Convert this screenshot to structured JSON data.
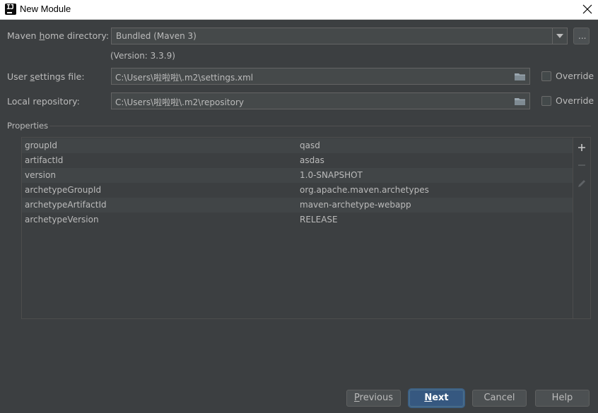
{
  "window": {
    "title": "New Module",
    "icon": "intellij-idea-icon",
    "close_icon": "close-icon"
  },
  "form": {
    "maven_home": {
      "label_pre": "Maven ",
      "label_mnemonic": "h",
      "label_post": "ome directory:",
      "value": "Bundled (Maven 3)",
      "browse_label": "...",
      "version": "(Version: 3.3.9)"
    },
    "user_settings": {
      "label_pre": "User ",
      "label_mnemonic": "s",
      "label_post": "ettings file:",
      "value": "C:\\Users\\啦啦啦\\.m2\\settings.xml",
      "override_label": "Override",
      "override_checked": false
    },
    "local_repo": {
      "label": "Local repository:",
      "value": "C:\\Users\\啦啦啦\\.m2\\repository",
      "override_label": "Override",
      "override_checked": false
    }
  },
  "properties": {
    "section_label": "Properties",
    "rows": [
      {
        "key": "groupId",
        "value": "qasd"
      },
      {
        "key": "artifactId",
        "value": "asdas"
      },
      {
        "key": "version",
        "value": "1.0-SNAPSHOT"
      },
      {
        "key": "archetypeGroupId",
        "value": "org.apache.maven.archetypes"
      },
      {
        "key": "archetypeArtifactId",
        "value": "maven-archetype-webapp"
      },
      {
        "key": "archetypeVersion",
        "value": "RELEASE"
      }
    ],
    "tools": [
      "add-icon",
      "remove-icon",
      "edit-icon"
    ]
  },
  "buttons": {
    "previous_mnemonic": "P",
    "previous_rest": "revious",
    "next_mnemonic": "N",
    "next_rest": "ext",
    "cancel": "Cancel",
    "help": "Help"
  },
  "colors": {
    "background": "#3c3f41",
    "field_bg": "#45494a",
    "primary_button": "#365880",
    "text": "#bbbbbb"
  }
}
